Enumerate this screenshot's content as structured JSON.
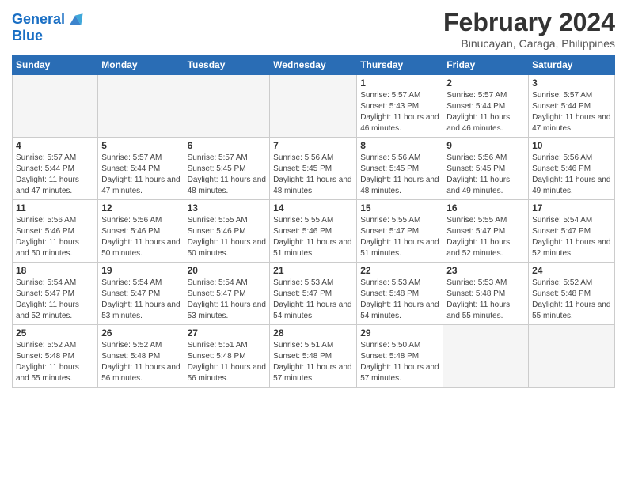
{
  "logo": {
    "line1": "General",
    "line2": "Blue"
  },
  "title": "February 2024",
  "subtitle": "Binucayan, Caraga, Philippines",
  "days_of_week": [
    "Sunday",
    "Monday",
    "Tuesday",
    "Wednesday",
    "Thursday",
    "Friday",
    "Saturday"
  ],
  "weeks": [
    [
      {
        "day": "",
        "info": ""
      },
      {
        "day": "",
        "info": ""
      },
      {
        "day": "",
        "info": ""
      },
      {
        "day": "",
        "info": ""
      },
      {
        "day": "1",
        "info": "Sunrise: 5:57 AM\nSunset: 5:43 PM\nDaylight: 11 hours and 46 minutes."
      },
      {
        "day": "2",
        "info": "Sunrise: 5:57 AM\nSunset: 5:44 PM\nDaylight: 11 hours and 46 minutes."
      },
      {
        "day": "3",
        "info": "Sunrise: 5:57 AM\nSunset: 5:44 PM\nDaylight: 11 hours and 47 minutes."
      }
    ],
    [
      {
        "day": "4",
        "info": "Sunrise: 5:57 AM\nSunset: 5:44 PM\nDaylight: 11 hours and 47 minutes."
      },
      {
        "day": "5",
        "info": "Sunrise: 5:57 AM\nSunset: 5:44 PM\nDaylight: 11 hours and 47 minutes."
      },
      {
        "day": "6",
        "info": "Sunrise: 5:57 AM\nSunset: 5:45 PM\nDaylight: 11 hours and 48 minutes."
      },
      {
        "day": "7",
        "info": "Sunrise: 5:56 AM\nSunset: 5:45 PM\nDaylight: 11 hours and 48 minutes."
      },
      {
        "day": "8",
        "info": "Sunrise: 5:56 AM\nSunset: 5:45 PM\nDaylight: 11 hours and 48 minutes."
      },
      {
        "day": "9",
        "info": "Sunrise: 5:56 AM\nSunset: 5:45 PM\nDaylight: 11 hours and 49 minutes."
      },
      {
        "day": "10",
        "info": "Sunrise: 5:56 AM\nSunset: 5:46 PM\nDaylight: 11 hours and 49 minutes."
      }
    ],
    [
      {
        "day": "11",
        "info": "Sunrise: 5:56 AM\nSunset: 5:46 PM\nDaylight: 11 hours and 50 minutes."
      },
      {
        "day": "12",
        "info": "Sunrise: 5:56 AM\nSunset: 5:46 PM\nDaylight: 11 hours and 50 minutes."
      },
      {
        "day": "13",
        "info": "Sunrise: 5:55 AM\nSunset: 5:46 PM\nDaylight: 11 hours and 50 minutes."
      },
      {
        "day": "14",
        "info": "Sunrise: 5:55 AM\nSunset: 5:46 PM\nDaylight: 11 hours and 51 minutes."
      },
      {
        "day": "15",
        "info": "Sunrise: 5:55 AM\nSunset: 5:47 PM\nDaylight: 11 hours and 51 minutes."
      },
      {
        "day": "16",
        "info": "Sunrise: 5:55 AM\nSunset: 5:47 PM\nDaylight: 11 hours and 52 minutes."
      },
      {
        "day": "17",
        "info": "Sunrise: 5:54 AM\nSunset: 5:47 PM\nDaylight: 11 hours and 52 minutes."
      }
    ],
    [
      {
        "day": "18",
        "info": "Sunrise: 5:54 AM\nSunset: 5:47 PM\nDaylight: 11 hours and 52 minutes."
      },
      {
        "day": "19",
        "info": "Sunrise: 5:54 AM\nSunset: 5:47 PM\nDaylight: 11 hours and 53 minutes."
      },
      {
        "day": "20",
        "info": "Sunrise: 5:54 AM\nSunset: 5:47 PM\nDaylight: 11 hours and 53 minutes."
      },
      {
        "day": "21",
        "info": "Sunrise: 5:53 AM\nSunset: 5:47 PM\nDaylight: 11 hours and 54 minutes."
      },
      {
        "day": "22",
        "info": "Sunrise: 5:53 AM\nSunset: 5:48 PM\nDaylight: 11 hours and 54 minutes."
      },
      {
        "day": "23",
        "info": "Sunrise: 5:53 AM\nSunset: 5:48 PM\nDaylight: 11 hours and 55 minutes."
      },
      {
        "day": "24",
        "info": "Sunrise: 5:52 AM\nSunset: 5:48 PM\nDaylight: 11 hours and 55 minutes."
      }
    ],
    [
      {
        "day": "25",
        "info": "Sunrise: 5:52 AM\nSunset: 5:48 PM\nDaylight: 11 hours and 55 minutes."
      },
      {
        "day": "26",
        "info": "Sunrise: 5:52 AM\nSunset: 5:48 PM\nDaylight: 11 hours and 56 minutes."
      },
      {
        "day": "27",
        "info": "Sunrise: 5:51 AM\nSunset: 5:48 PM\nDaylight: 11 hours and 56 minutes."
      },
      {
        "day": "28",
        "info": "Sunrise: 5:51 AM\nSunset: 5:48 PM\nDaylight: 11 hours and 57 minutes."
      },
      {
        "day": "29",
        "info": "Sunrise: 5:50 AM\nSunset: 5:48 PM\nDaylight: 11 hours and 57 minutes."
      },
      {
        "day": "",
        "info": ""
      },
      {
        "day": "",
        "info": ""
      }
    ]
  ]
}
